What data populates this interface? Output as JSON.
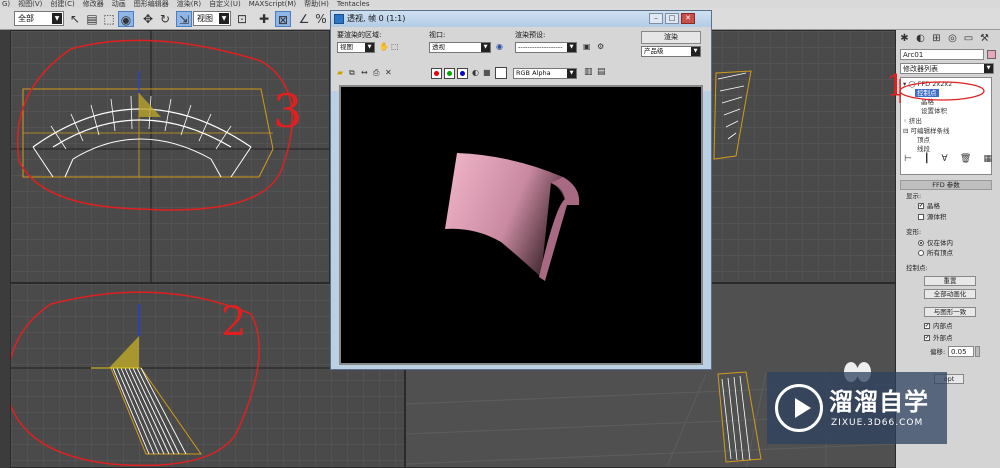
{
  "menubar": {
    "items": [
      "G)",
      "视图(V)",
      "创建(C)",
      "修改器",
      "动画",
      "图形编辑器",
      "渲染(R)",
      "自定义(U)",
      "MAXScript(M)",
      "帮助(H)",
      "Tentacles"
    ]
  },
  "toolbar": {
    "selection_filter": "全部",
    "reference_coord": "视图"
  },
  "render_window": {
    "title": "透视, 帧 0 (1:1)",
    "area_label": "要渲染的区域:",
    "area_value": "视图",
    "viewport_label": "视口:",
    "viewport_value": "透视",
    "preset_label": "渲染预设:",
    "preset_value": "-------------------",
    "render_button": "渲染",
    "product_value": "产品级",
    "channel_value": "RGB Alpha",
    "min_btn": "–",
    "max_btn": "□",
    "close_btn": "✕"
  },
  "command_panel": {
    "object_name": "Arc01",
    "modifier_list": "修改器列表",
    "stack": [
      "FFD 2x2x2",
      "控制点",
      "晶格",
      "设置体积",
      "挤出",
      "可编辑样条线",
      "顶点",
      "线段"
    ],
    "rollout_title": "FFD 参数",
    "display_label": "显示:",
    "lattice_label": "晶格",
    "source_volume_label": "源体积",
    "deform_label": "变形:",
    "only_in_volume": "仅在体内",
    "all_vertices": "所有顶点",
    "control_points_label": "控制点:",
    "reset_button": "重置",
    "animate_all_button": "全部动画化",
    "conform_button": "与图形一致",
    "inside_points": "内部点",
    "outside_points": "外部点",
    "offset_label": "偏移:",
    "offset_value": "0.05",
    "script_frag": "opt"
  },
  "annotations": {
    "n1": "1",
    "n2": "2",
    "n3": "3"
  },
  "watermark": {
    "brand": "溜溜自学",
    "url": "ZIXUE.3D66.COM"
  },
  "colors": {
    "accent": "#3e6ec9",
    "mesh": "#ffffff",
    "bbox": "#d39b1a",
    "annot": "#e02020",
    "render_obj": "#e7a6bd"
  }
}
